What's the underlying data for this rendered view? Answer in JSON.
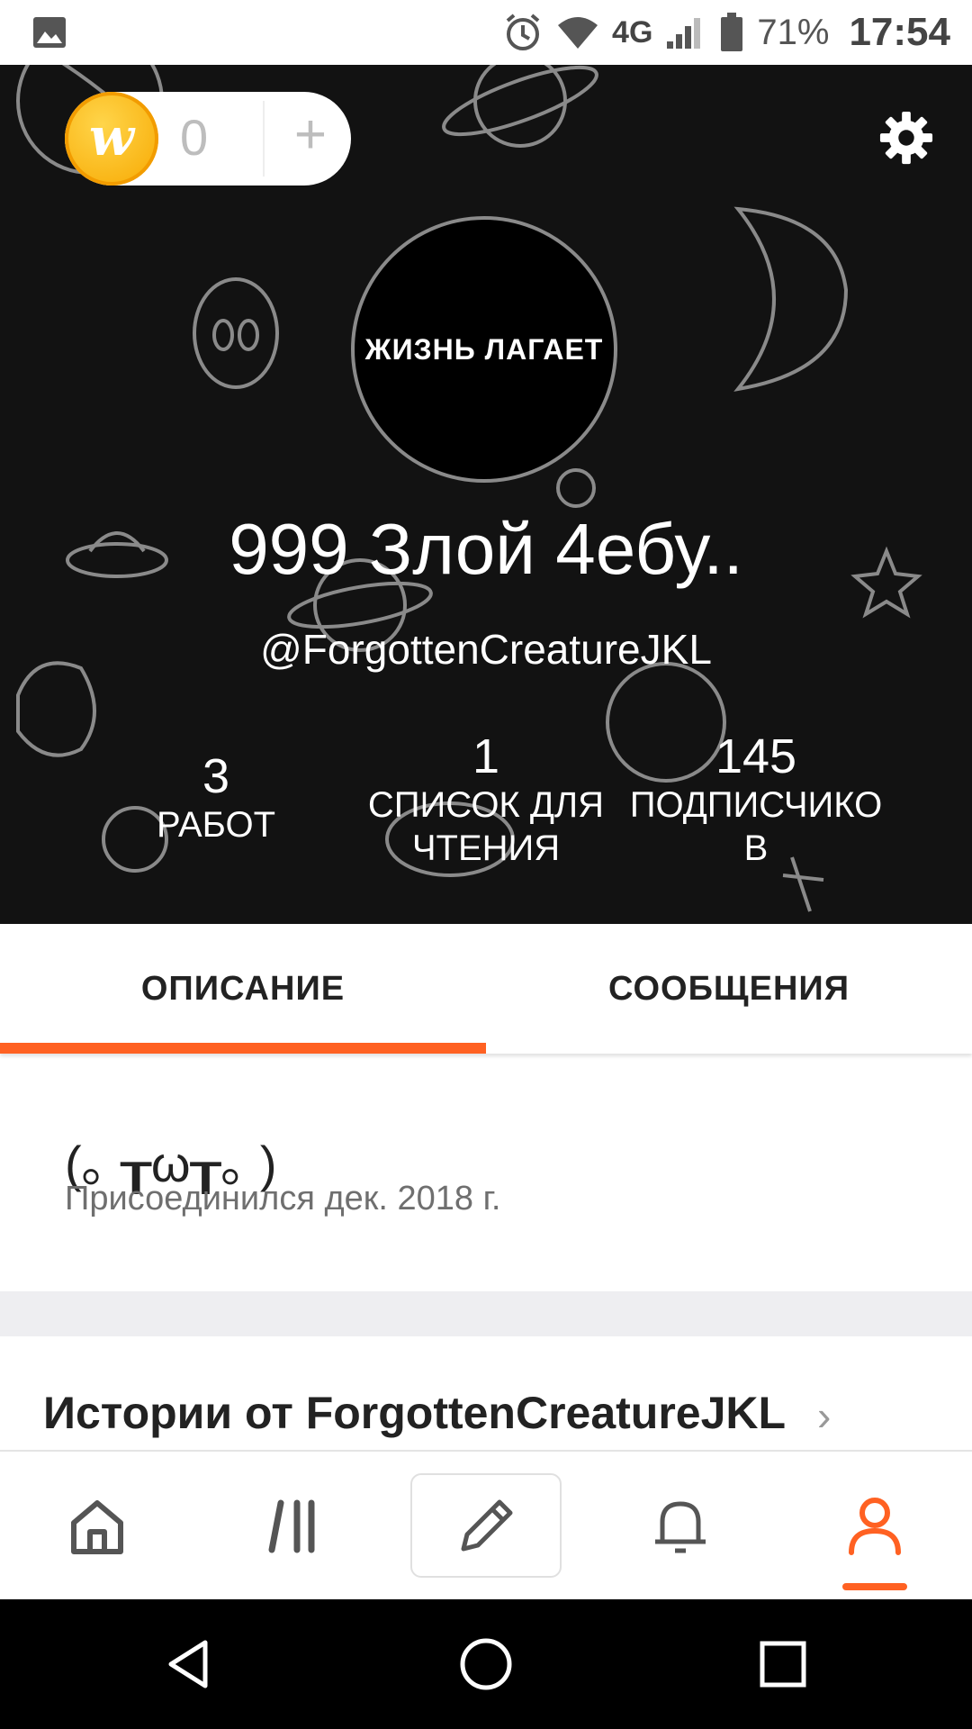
{
  "status_bar": {
    "network": "4G",
    "battery": "71%",
    "time": "17:54"
  },
  "coins": {
    "logo_letter": "w",
    "count": "0",
    "add_label": "+"
  },
  "avatar_text": "ЖИЗНЬ ЛАГАЕТ",
  "profile": {
    "display_name": "999 Злой 4ебу..",
    "username": "@ForgottenCreatureJKL"
  },
  "stats": [
    {
      "number": "3",
      "label": "РАБОТ"
    },
    {
      "number": "1",
      "label": "СПИСОК ДЛЯ ЧТЕНИЯ"
    },
    {
      "number": "145",
      "label": "ПОДПИСЧИКО В"
    }
  ],
  "tabs": [
    {
      "label": "ОПИСАНИЕ",
      "active": true
    },
    {
      "label": "СООБЩЕНИЯ",
      "active": false
    }
  ],
  "about": {
    "emote": "(｡ ┰ω┰｡ )",
    "joined": "Присоединился дек. 2018 г."
  },
  "stories": {
    "title": "Истории от ForgottenCreatureJKL",
    "chevron": "›"
  },
  "bottom_nav": [
    {
      "icon": "home-icon",
      "active": false
    },
    {
      "icon": "library-icon",
      "active": false
    },
    {
      "icon": "pencil-icon",
      "active": false
    },
    {
      "icon": "bell-icon",
      "active": false
    },
    {
      "icon": "profile-icon",
      "active": true
    }
  ],
  "colors": {
    "accent": "#ff6122",
    "header_bg": "#121212",
    "coin": "#f7a800"
  }
}
